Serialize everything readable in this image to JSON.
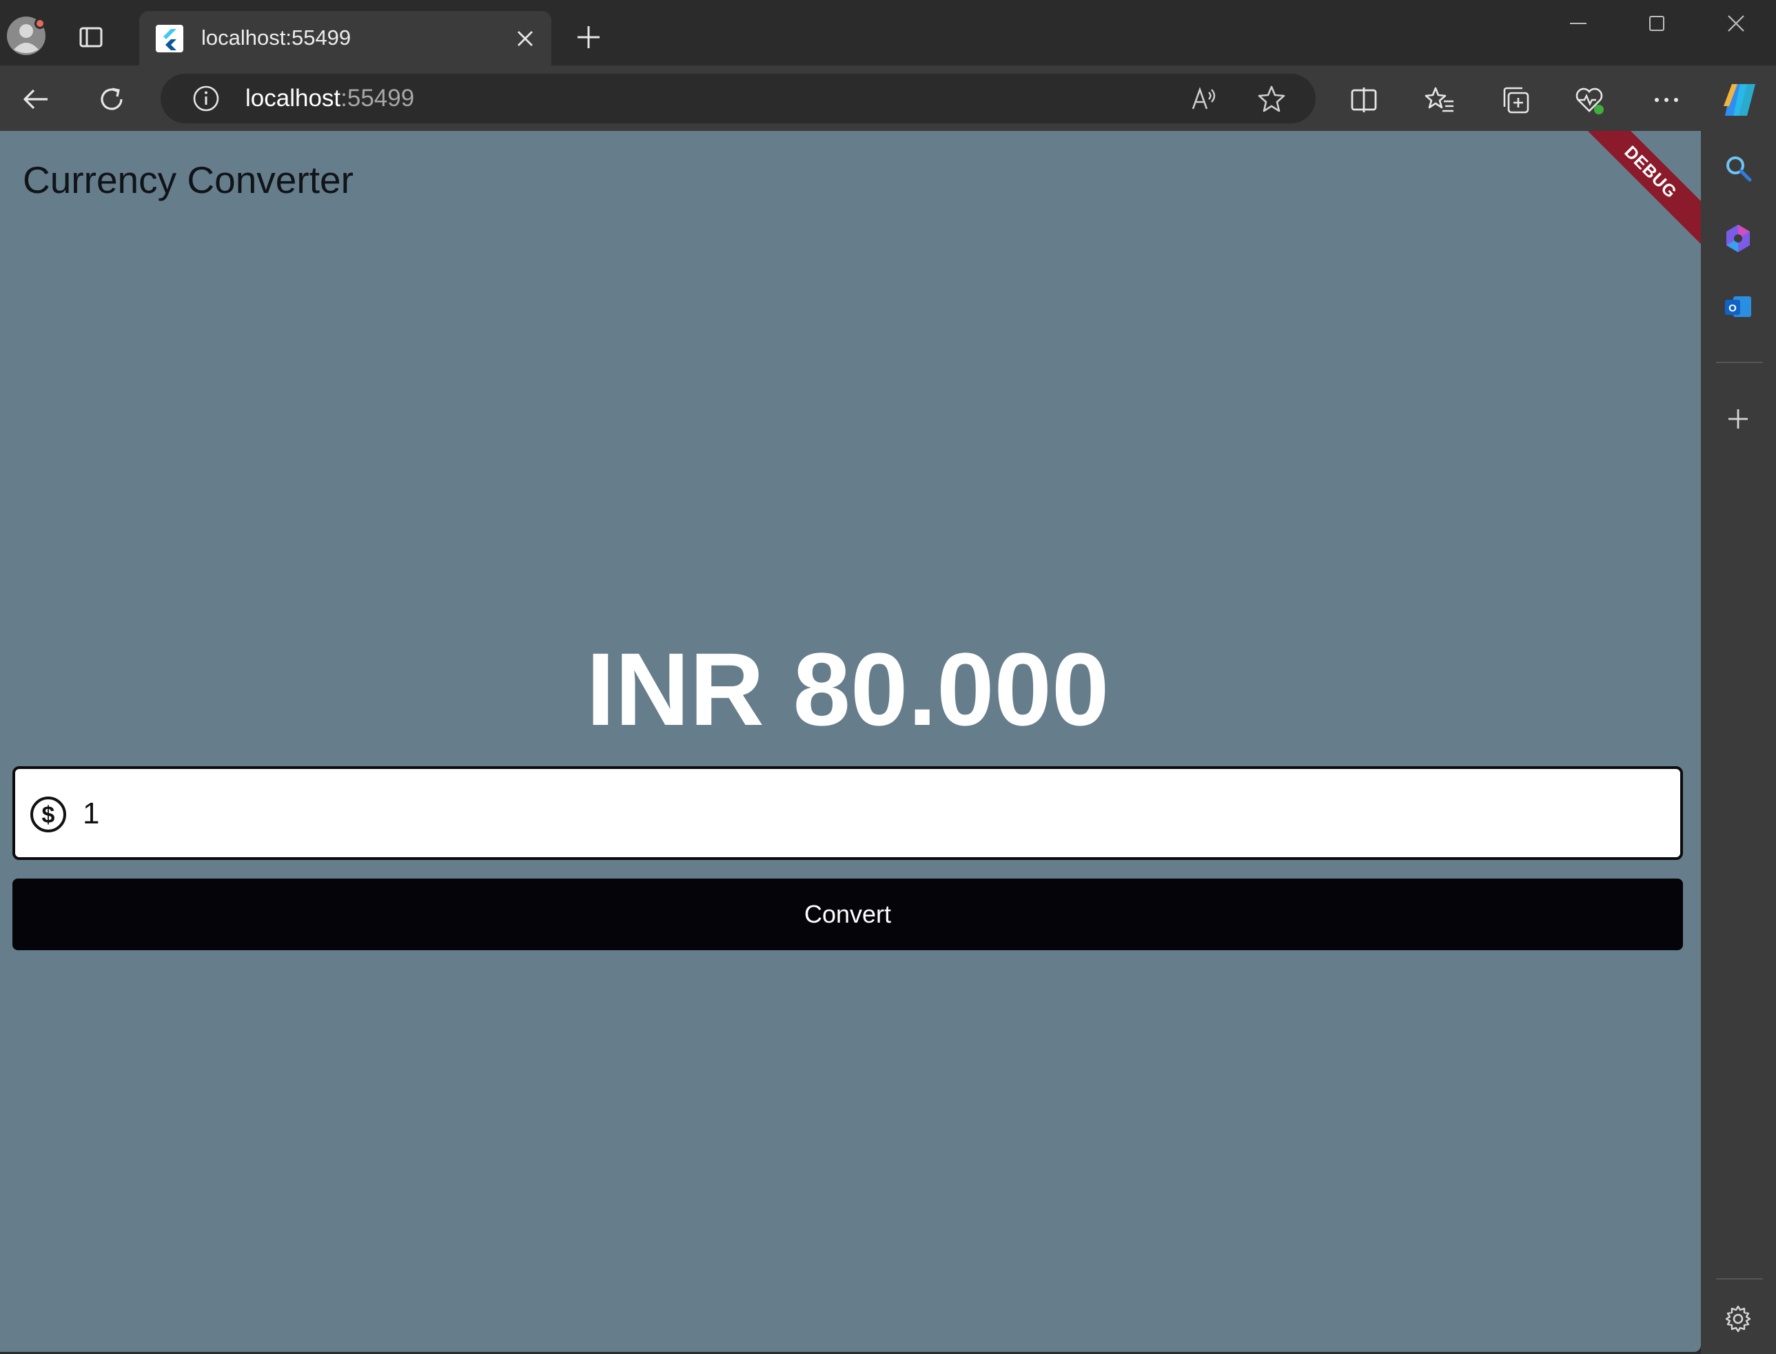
{
  "browser": {
    "tab": {
      "title": "localhost:55499"
    },
    "address_bar": {
      "host": "localhost",
      "port": ":55499"
    }
  },
  "app": {
    "title": "Currency Converter",
    "debug_banner": "DEBUG",
    "result_text": "INR 80.000",
    "amount_input": {
      "value": "1",
      "prefix_icon": "dollar-circle-icon"
    },
    "convert_button": "Convert"
  },
  "colors": {
    "page_background": "#667d8b",
    "button_background": "#050509",
    "debug_banner": "#8b1a2b"
  }
}
